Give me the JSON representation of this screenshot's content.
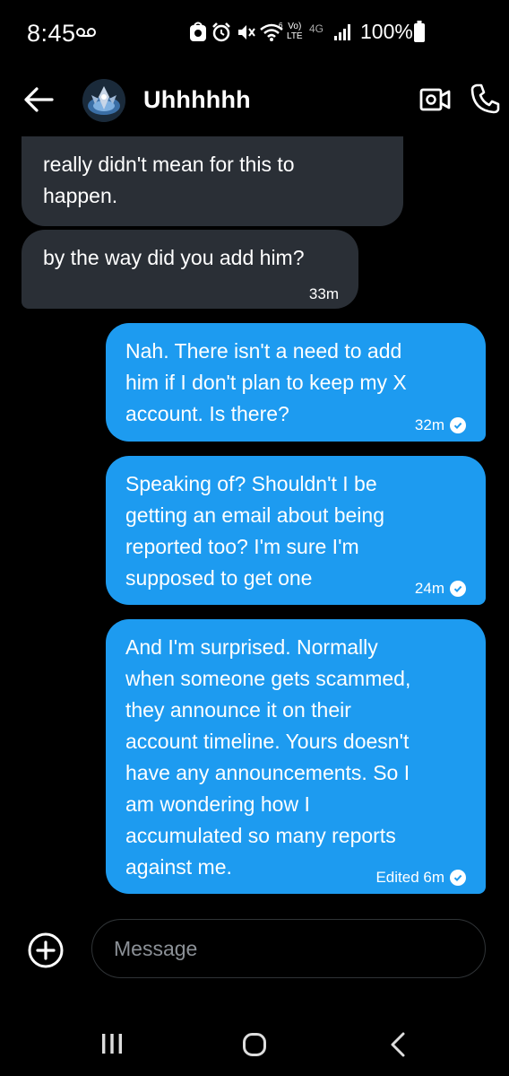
{
  "status_bar": {
    "time": "8:45",
    "network": "4G",
    "volte": "Vo)\nLTE",
    "battery_percent": "100%"
  },
  "header": {
    "title": "Uhhhhhh",
    "back_icon": "arrow-left-icon",
    "video_icon": "video-camera-icon",
    "phone_icon": "phone-icon"
  },
  "messages": [
    {
      "direction": "received",
      "text": "really didn't mean for this to\nhappen.",
      "time": ""
    },
    {
      "direction": "received",
      "text": "by the way did you add him?",
      "time": "33m"
    },
    {
      "direction": "sent",
      "text": "Nah. There isn't a need to add\nhim if I don't plan to keep my X\naccount. Is there?",
      "time": "32m"
    },
    {
      "direction": "sent",
      "text": "Speaking of? Shouldn't I be\ngetting an email about being\nreported too? I'm sure I'm\nsupposed to get one",
      "time": "24m"
    },
    {
      "direction": "sent",
      "text": "And I'm surprised. Normally\nwhen someone gets scammed,\nthey announce it on their\naccount timeline. Yours doesn't\nhave any announcements. So I\nam wondering how I\naccumulated so many reports\nagainst me.",
      "time": "Edited 6m"
    }
  ],
  "composer": {
    "placeholder": "Message",
    "add_icon": "plus-circle-icon"
  },
  "colors": {
    "sent_bubble": "#1d9bf0",
    "received_bubble": "#2a2f36",
    "background": "#000000"
  }
}
